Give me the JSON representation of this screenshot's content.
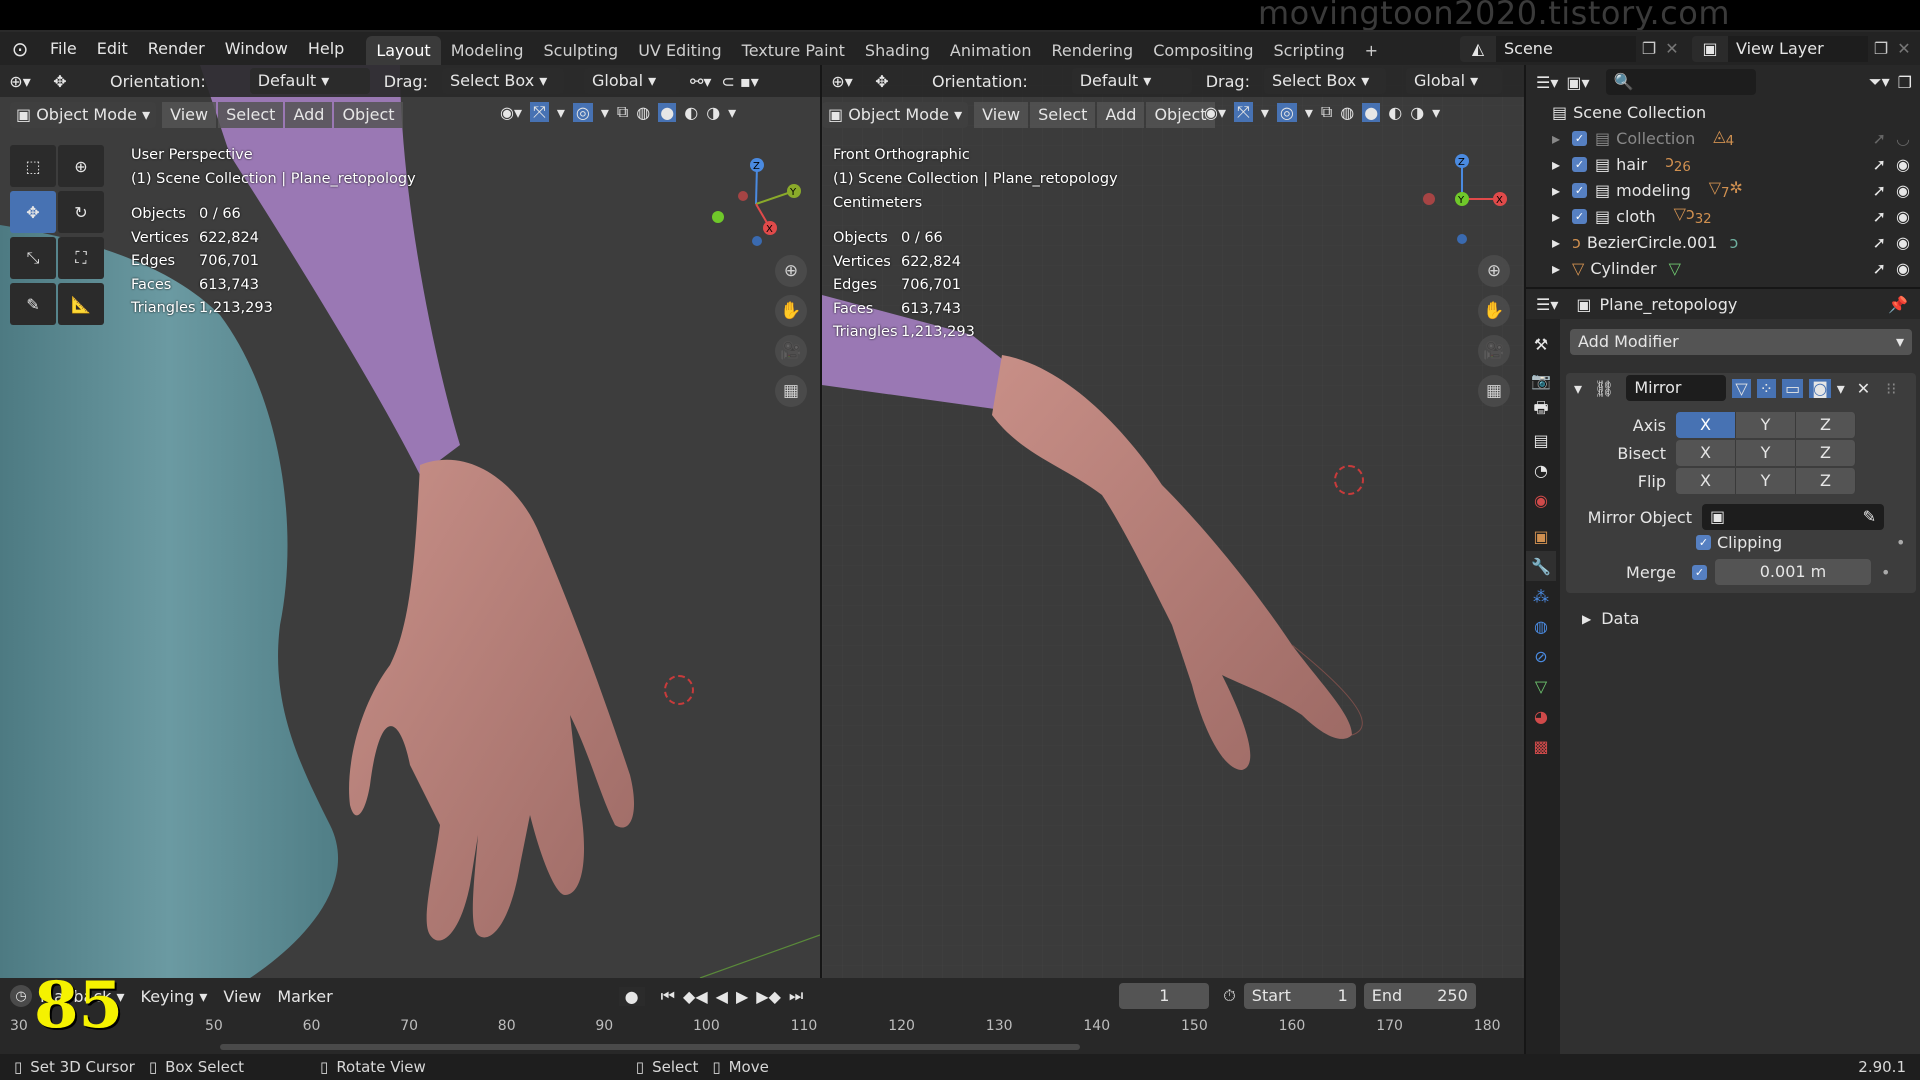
{
  "watermark": "movingtoon2020.tistory.com",
  "menu": [
    "File",
    "Edit",
    "Render",
    "Window",
    "Help"
  ],
  "workspaces": [
    "Layout",
    "Modeling",
    "Sculpting",
    "UV Editing",
    "Texture Paint",
    "Shading",
    "Animation",
    "Rendering",
    "Compositing",
    "Scripting",
    "+"
  ],
  "scene": {
    "label": "Scene",
    "view_layer": "View Layer"
  },
  "left_header": {
    "orientation_label": "Orientation:",
    "orientation_value": "Default",
    "drag_label": "Drag:",
    "drag_value": "Select Box",
    "transform": "Global"
  },
  "left_viewport": {
    "mode": "Object Mode",
    "menus": [
      "View",
      "Select",
      "Add",
      "Object"
    ],
    "title": "User Perspective",
    "collection": "(1) Scene Collection | Plane_retopology",
    "stats": [
      {
        "k": "Objects",
        "v": "0 / 66"
      },
      {
        "k": "Vertices",
        "v": "622,824"
      },
      {
        "k": "Edges",
        "v": "706,701"
      },
      {
        "k": "Faces",
        "v": "613,743"
      },
      {
        "k": "Triangles",
        "v": "1,213,293"
      }
    ]
  },
  "right_header": {
    "orientation_label": "Orientation:",
    "orientation_value": "Default",
    "drag_label": "Drag:",
    "drag_value": "Select Box",
    "transform": "Global"
  },
  "right_viewport": {
    "mode": "Object Mode",
    "menus": [
      "View",
      "Select",
      "Add",
      "Object"
    ],
    "title": "Front Orthographic",
    "collection": "(1) Scene Collection | Plane_retopology",
    "units": "Centimeters",
    "stats": [
      {
        "k": "Objects",
        "v": "0 / 66"
      },
      {
        "k": "Vertices",
        "v": "622,824"
      },
      {
        "k": "Edges",
        "v": "706,701"
      },
      {
        "k": "Faces",
        "v": "613,743"
      },
      {
        "k": "Triangles",
        "v": "1,213,293"
      }
    ]
  },
  "outliner": {
    "root": "Scene Collection",
    "items": [
      {
        "name": "Collection",
        "badge": "4",
        "checked": true,
        "dim": true
      },
      {
        "name": "hair",
        "badge": "26",
        "checked": true
      },
      {
        "name": "modeling",
        "badge": "7",
        "checked": true
      },
      {
        "name": "cloth",
        "badge": "32",
        "checked": true
      },
      {
        "name": "BezierCircle.001",
        "checked": false
      },
      {
        "name": "Cylinder",
        "checked": false
      }
    ]
  },
  "properties": {
    "object": "Plane_retopology",
    "add_modifier": "Add Modifier",
    "modifier_name": "Mirror",
    "axis_label": "Axis",
    "bisect_label": "Bisect",
    "flip_label": "Flip",
    "axes": [
      "X",
      "Y",
      "Z"
    ],
    "mirror_object_label": "Mirror Object",
    "clipping_label": "Clipping",
    "merge_label": "Merge",
    "merge_value": "0.001 m",
    "data_label": "Data"
  },
  "timeline": {
    "playback": "Playback",
    "keying": "Keying",
    "view": "View",
    "marker": "Marker",
    "current_frame": "1",
    "start_label": "Start",
    "start": "1",
    "end_label": "End",
    "end": "250",
    "ticks": [
      "30",
      "50",
      "60",
      "70",
      "80",
      "90",
      "100",
      "110",
      "120",
      "130",
      "140",
      "150",
      "160",
      "170",
      "180"
    ],
    "overlay_number": "85"
  },
  "status": {
    "a": "Set 3D Cursor",
    "b": "Box Select",
    "c": "Rotate View",
    "d": "Select",
    "e": "Move",
    "version": "2.90.1"
  },
  "colors": {
    "accent": "#4772b3",
    "sleeve": "#9c7bb4",
    "skin": "#b5807a",
    "pants": "#5f8d95",
    "viewport": "#3a3a3a"
  }
}
